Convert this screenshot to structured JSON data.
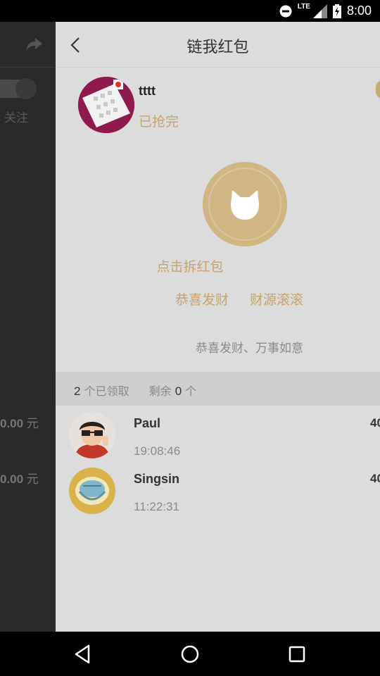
{
  "status_bar": {
    "network": "LTE",
    "time": "8:00"
  },
  "left_page": {
    "follow_label": "关注",
    "amounts": [
      {
        "value": "0.00",
        "unit": "元"
      },
      {
        "value": "0.00",
        "unit": "元"
      }
    ]
  },
  "header": {
    "title": "链我红包"
  },
  "sender": {
    "name": "tttt",
    "status": "已抢完"
  },
  "open_label": "点击拆红包",
  "blessings": [
    "恭喜发财",
    "财源滚滚"
  ],
  "message": "恭喜发财、万事如意",
  "summary": {
    "received_count": "2",
    "received_label": "个已领取",
    "remaining_label": "剩余",
    "remaining_count": "0",
    "remaining_unit": "个"
  },
  "records": [
    {
      "name": "Paul",
      "time": "19:08:46",
      "amount": "40"
    },
    {
      "name": "Singsin",
      "time": "11:22:31",
      "amount": "40"
    }
  ],
  "colors": {
    "gold": "#c5a56a",
    "panel_bg": "#dcdcdc",
    "drawer_bg": "#2a2a2a"
  }
}
